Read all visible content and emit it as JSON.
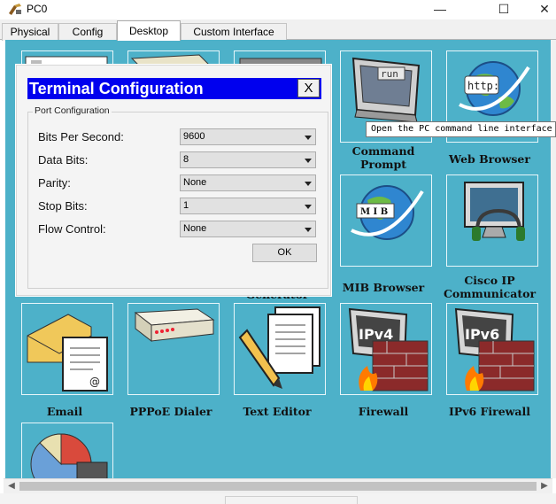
{
  "window": {
    "title": "PC0",
    "minimize_glyph": "—",
    "maximize_glyph": "☐",
    "close_glyph": "✕"
  },
  "tabs": [
    {
      "label": "Physical",
      "active": false
    },
    {
      "label": "Config",
      "active": false
    },
    {
      "label": "Desktop",
      "active": true
    },
    {
      "label": "Custom Interface",
      "active": false
    }
  ],
  "apps": {
    "command_prompt": {
      "label": "Command Prompt",
      "icon": "command-prompt-icon",
      "icon_text": "run"
    },
    "web_browser": {
      "label": "Web Browser",
      "icon": "web-browser-icon",
      "icon_text": "http:"
    },
    "mib_browser": {
      "label": "MIB Browser",
      "icon": "mib-browser-icon",
      "icon_text": "M I B"
    },
    "cisco_ip_communicator": {
      "label": "Cisco IP Communicator",
      "icon": "headset-monitor-icon"
    },
    "generator_partial": {
      "label": "Generator"
    },
    "email": {
      "label": "Email",
      "icon": "email-icon"
    },
    "pppoe_dialer": {
      "label": "PPPoE Dialer",
      "icon": "modem-icon"
    },
    "text_editor": {
      "label": "Text Editor",
      "icon": "text-editor-icon"
    },
    "firewall": {
      "label": "Firewall",
      "icon": "firewall-icon",
      "icon_text": "IPv4"
    },
    "ipv6_firewall": {
      "label": "IPv6 Firewall",
      "icon": "ipv6-firewall-icon",
      "icon_text": "IPv6"
    }
  },
  "tooltip": {
    "text": "Open the PC command line interface"
  },
  "dialog": {
    "title": "Terminal Configuration",
    "close_label": "X",
    "group_title": "Port Configuration",
    "fields": [
      {
        "label": "Bits Per Second:",
        "value": "9600"
      },
      {
        "label": "Data Bits:",
        "value": "8"
      },
      {
        "label": "Parity:",
        "value": "None"
      },
      {
        "label": "Stop Bits:",
        "value": "1"
      },
      {
        "label": "Flow Control:",
        "value": "None"
      }
    ],
    "ok_label": "OK"
  },
  "colors": {
    "desktop_bg": "#4db1c9",
    "dialog_title_bg": "#0000ee"
  },
  "scrollbar": {
    "left_arrow": "◀",
    "right_arrow": "▶"
  }
}
